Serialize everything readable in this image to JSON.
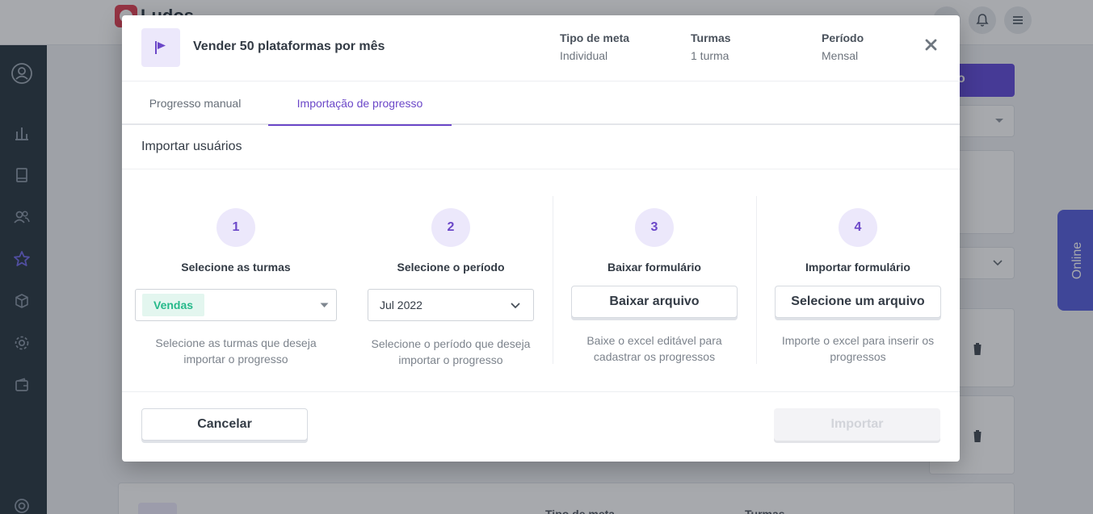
{
  "app": {
    "brand": "Ludos"
  },
  "background": {
    "online_label": "Online",
    "bottom_card": {
      "meta_label_1": "Tipo de meta",
      "meta_label_2": "Turmas"
    }
  },
  "modal": {
    "goal_title": "Vender 50 plataformas por mês",
    "meta": [
      {
        "label": "Tipo de meta",
        "value": "Individual"
      },
      {
        "label": "Turmas",
        "value": "1 turma"
      },
      {
        "label": "Período",
        "value": "Mensal"
      }
    ],
    "tabs": [
      {
        "label": "Progresso manual",
        "active": false
      },
      {
        "label": "Importação de progresso",
        "active": true
      }
    ],
    "section_title": "Importar usuários",
    "steps": [
      {
        "number": "1",
        "title": "Selecione as turmas",
        "chip": "Vendas",
        "description": "Selecione as turmas que deseja importar o progresso"
      },
      {
        "number": "2",
        "title": "Selecione o período",
        "selected": "Jul 2022",
        "description": "Selecione o período que deseja importar o progresso"
      },
      {
        "number": "3",
        "title": "Baixar formulário",
        "button": "Baixar arquivo",
        "description": "Baixe o excel editável para cadastrar os progressos"
      },
      {
        "number": "4",
        "title": "Importar formulário",
        "button": "Selecione um arquivo",
        "description": "Importe o excel para inserir os progressos"
      }
    ],
    "footer": {
      "cancel": "Cancelar",
      "import": "Importar"
    }
  },
  "colors": {
    "accent": "#6b47c8",
    "accent_light": "#ece8fb",
    "chip_text": "#26b98a",
    "chip_bg": "#e3f6ef",
    "sidebar": "#1d2b36",
    "online_tab": "#4d55db"
  },
  "icons": {
    "goal": "flag-icon",
    "close": "close-icon",
    "dropdown": "chevron-down-icon",
    "delete": "trash-icon"
  }
}
